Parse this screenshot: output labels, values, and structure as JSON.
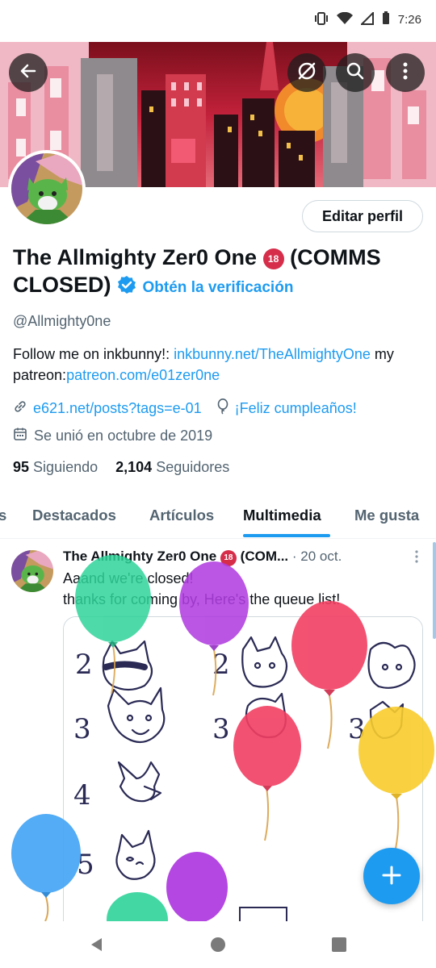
{
  "status_bar": {
    "time": "7:26"
  },
  "profile": {
    "name": "The Allmighty Zer0 One",
    "age_badge": "18",
    "name_suffix": "(COMMS CLOSED)",
    "verify_label": "Obtén la verificación",
    "edit_button": "Editar perfil",
    "handle": "@Allmighty0ne",
    "bio_prefix": "Follow me on inkbunny!: ",
    "bio_link1": "inkbunny.net/TheAllmightyOne",
    "bio_middle": " my patreon:",
    "bio_link2": "patreon.com/e01zer0ne",
    "website": "e621.net/posts?tags=e-01",
    "birthday": "¡Feliz cumpleaños!",
    "joined": "Se unió en octubre de 2019",
    "following_count": "95",
    "following_label": "Siguiendo",
    "followers_count": "2,104",
    "followers_label": "Seguidores"
  },
  "tabs": [
    {
      "label": "s"
    },
    {
      "label": "Destacados"
    },
    {
      "label": "Artículos"
    },
    {
      "label": "Multimedia",
      "active": true
    },
    {
      "label": "Me gusta"
    }
  ],
  "tweet": {
    "author": "The Allmighty Zer0 One",
    "age_badge": "18",
    "author_suffix": "(COM...",
    "date": "· 20 oct.",
    "line1": "Aaand we're closed!",
    "line2": "thanks for coming by, Here's the queue list!",
    "media_numbers": [
      "2",
      "3",
      "4",
      "5",
      "2",
      "3",
      "3"
    ]
  },
  "colors": {
    "accent": "#1d9bf0",
    "text_primary": "#0f1419",
    "text_secondary": "#536471"
  },
  "icons": {
    "back": "back-arrow-icon",
    "unfollow": "slashed-circle-icon",
    "search": "search-icon",
    "more": "more-vertical-icon",
    "link": "link-icon",
    "balloon": "balloon-icon",
    "calendar": "calendar-icon",
    "compose": "plus-icon"
  }
}
